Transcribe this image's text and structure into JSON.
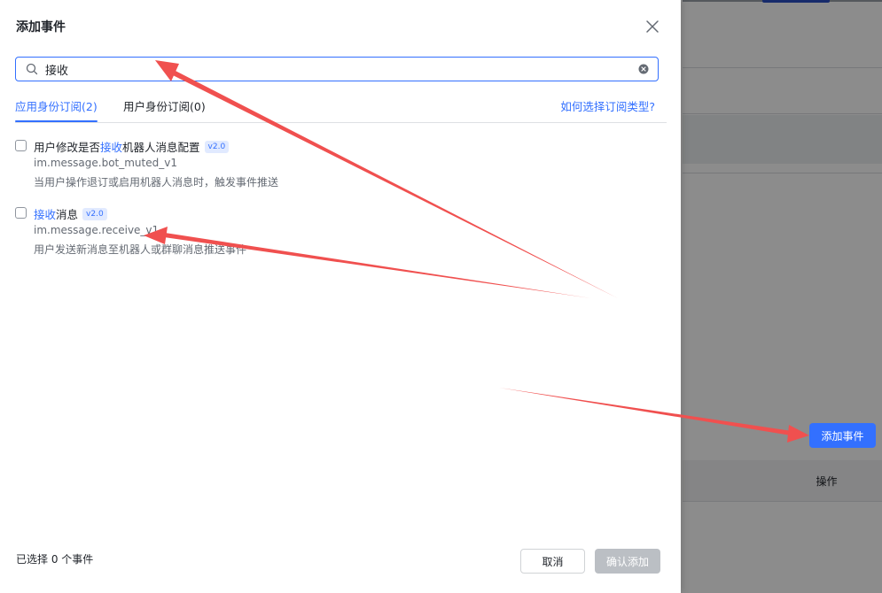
{
  "background": {
    "add_event_button": "添加事件",
    "table_header_action": "操作"
  },
  "drawer": {
    "title": "添加事件",
    "search": {
      "value": "接收"
    },
    "tabs": [
      {
        "label": "应用身份订阅(2)",
        "active": true
      },
      {
        "label": "用户身份订阅(0)",
        "active": false
      }
    ],
    "help_link": "如何选择订阅类型?",
    "events": [
      {
        "title_before": "用户修改是否",
        "title_highlight": "接收",
        "title_after": "机器人消息配置",
        "version": "v2.0",
        "key": "im.message.bot_muted_v1",
        "description": "当用户操作退订或启用机器人消息时，触发事件推送"
      },
      {
        "title_before": "",
        "title_highlight": "接收",
        "title_after": "消息",
        "version": "v2.0",
        "key": "im.message.receive_v1",
        "description": "用户发送新消息至机器人或群聊消息推送事件"
      }
    ],
    "footer": {
      "selected_count": "已选择 0 个事件",
      "cancel_label": "取消",
      "confirm_label": "确认添加"
    }
  },
  "colors": {
    "accent": "#3370ff",
    "annotation_arrow": "#f0504f",
    "disabled_button": "#bbbfc4"
  }
}
